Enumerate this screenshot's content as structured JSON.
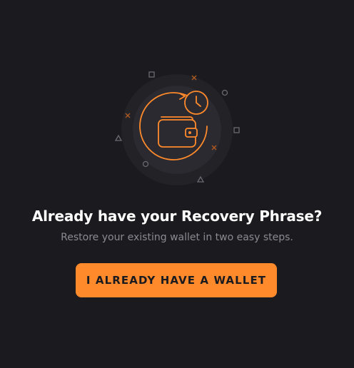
{
  "illustration": {
    "icon": "wallet-with-clock-icon",
    "accent_color": "#ff8a2b"
  },
  "content": {
    "heading": "Already have your Recovery Phrase?",
    "subtext": "Restore your existing wallet in two easy steps."
  },
  "actions": {
    "primary_label": "I ALREADY HAVE A WALLET"
  },
  "colors": {
    "background": "#1b1b1f",
    "accent": "#ff8a2b",
    "heading": "#ffffff",
    "subtext": "#8a8a90"
  }
}
